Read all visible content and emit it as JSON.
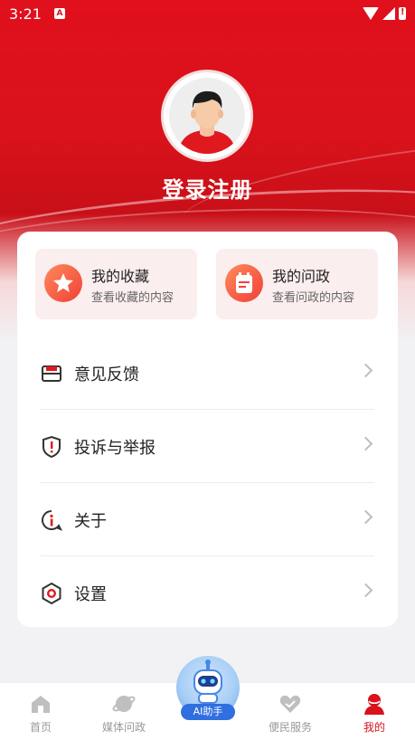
{
  "status_bar": {
    "time": "3:21",
    "sim_badge": "A"
  },
  "profile": {
    "login_label": "登录注册"
  },
  "quick_actions": [
    {
      "title": "我的收藏",
      "subtitle": "查看收藏的内容",
      "icon": "star-icon"
    },
    {
      "title": "我的问政",
      "subtitle": "查看问政的内容",
      "icon": "notepad-icon"
    }
  ],
  "menu": [
    {
      "label": "意见反馈",
      "icon": "feedback-envelope-icon"
    },
    {
      "label": "投诉与举报",
      "icon": "shield-alert-icon"
    },
    {
      "label": "关于",
      "icon": "info-bubble-icon"
    },
    {
      "label": "设置",
      "icon": "hexagon-settings-icon"
    }
  ],
  "tabbar": {
    "items": [
      {
        "label": "首页",
        "icon": "home-icon"
      },
      {
        "label": "媒体问政",
        "icon": "planet-icon"
      },
      {
        "label": "便民服务",
        "icon": "heart-hand-icon"
      },
      {
        "label": "我的",
        "icon": "person-icon",
        "active": true
      }
    ],
    "ai_label": "AI助手"
  },
  "colors": {
    "accent": "#d9121b",
    "quick_bg": "#fbeeee"
  }
}
